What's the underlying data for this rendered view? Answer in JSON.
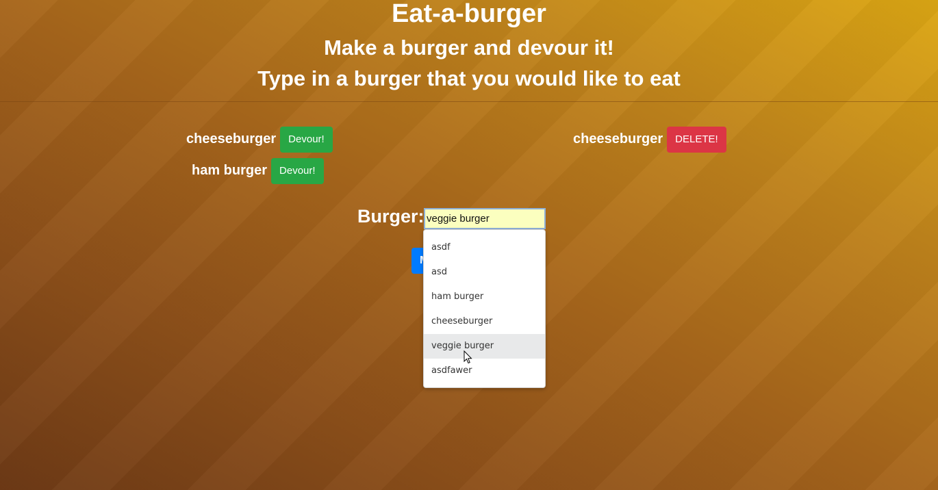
{
  "header": {
    "title": "Eat-a-burger",
    "subtitle": "Make a burger and devour it!",
    "instructions": "Type in a burger that you would like to eat"
  },
  "to_eat": [
    {
      "name": "cheeseburger",
      "button": "Devour!"
    },
    {
      "name": "ham burger",
      "button": "Devour!"
    }
  ],
  "devoured": [
    {
      "name": "cheeseburger",
      "button": "DELETE!"
    }
  ],
  "form": {
    "label": "Burger:",
    "input_value": "veggie burger",
    "submit_label": "Make it!"
  },
  "autocomplete": {
    "options": [
      "asdf",
      "asd",
      "ham burger",
      "cheeseburger",
      "veggie burger",
      "asdfawer"
    ],
    "highlighted": "veggie burger"
  },
  "colors": {
    "devour_button": "#28a745",
    "delete_button": "#dc3545",
    "submit_button": "#007bff",
    "input_autofill": "#fbffbf"
  },
  "icons": {
    "pointer": "mouse-pointer-icon"
  }
}
